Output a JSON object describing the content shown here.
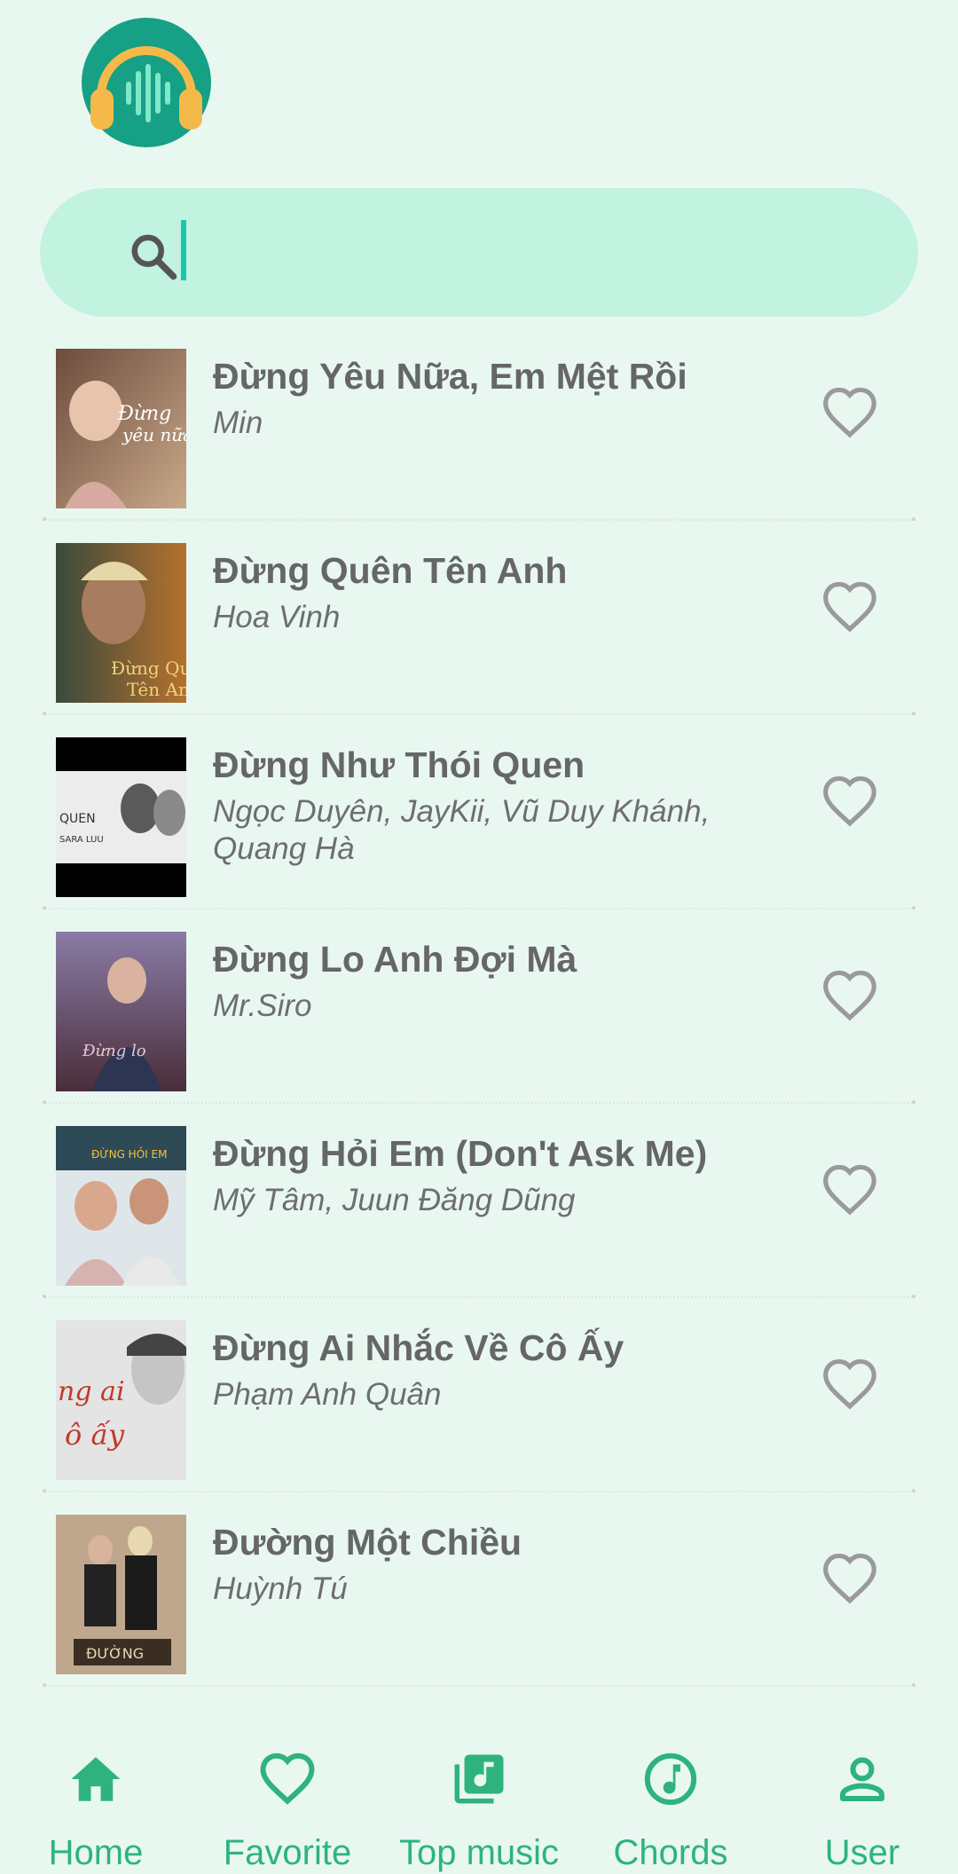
{
  "app": {
    "logo_icon": "headphones-logo-icon",
    "accent": "#2fb37e",
    "caret": "#17c8a8"
  },
  "search": {
    "icon": "search-icon",
    "value": "",
    "placeholder": ""
  },
  "songs": [
    {
      "title": "Đừng Yêu Nữa, Em Mệt Rồi",
      "artist": "Min"
    },
    {
      "title": "Đừng Quên Tên Anh",
      "artist": "Hoa Vinh"
    },
    {
      "title": "Đừng Như Thói Quen",
      "artist": "Ngọc Duyên, JayKii, Vũ Duy Khánh, Quang Hà"
    },
    {
      "title": "Đừng Lo Anh Đợi Mà",
      "artist": "Mr.Siro"
    },
    {
      "title": "Đừng Hỏi Em (Don't Ask Me)",
      "artist": "Mỹ Tâm, Juun Đăng Dũng"
    },
    {
      "title": "Đừng Ai Nhắc Về Cô Ấy",
      "artist": "Phạm Anh Quân"
    },
    {
      "title": "Đường Một Chiều",
      "artist": "Huỳnh Tú"
    }
  ],
  "nav": {
    "items": [
      {
        "label": "Home",
        "icon": "home-icon"
      },
      {
        "label": "Favorite",
        "icon": "heart-icon"
      },
      {
        "label": "Top music",
        "icon": "music-library-icon"
      },
      {
        "label": "Chords",
        "icon": "music-note-circle-icon"
      },
      {
        "label": "User",
        "icon": "user-icon"
      }
    ]
  }
}
